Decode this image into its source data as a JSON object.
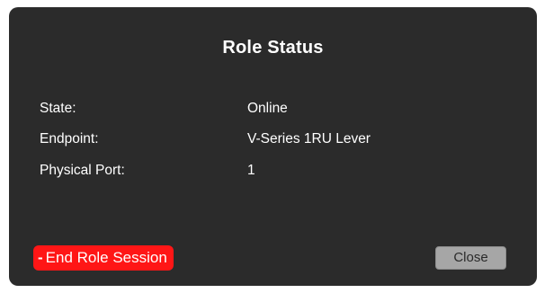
{
  "dialog": {
    "title": "Role Status",
    "fields": [
      {
        "label": "State:",
        "value": "Online"
      },
      {
        "label": "Endpoint:",
        "value": "V-Series 1RU Lever"
      },
      {
        "label": "Physical Port:",
        "value": "1"
      }
    ],
    "end_session": {
      "icon": "minus-icon",
      "icon_glyph": "-",
      "label": "End Role Session",
      "color": "#ff1616"
    },
    "close_label": "Close",
    "colors": {
      "background": "#2b2b2b",
      "close_button": "#a6a6a6"
    }
  }
}
